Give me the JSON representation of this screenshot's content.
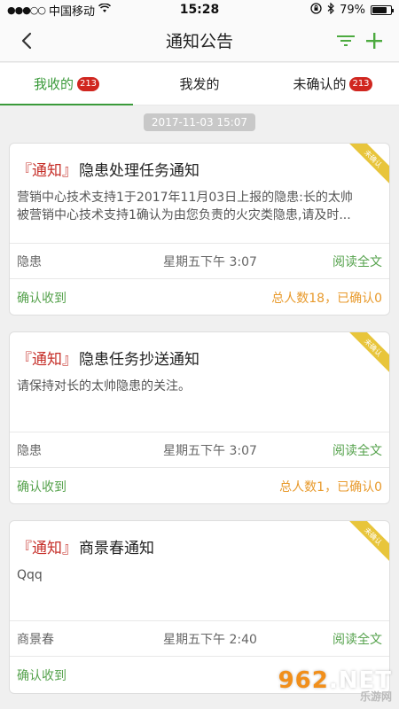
{
  "status_bar": {
    "carrier": "中国移动",
    "time": "15:28",
    "battery": "79%",
    "battery_level": 0.79
  },
  "nav": {
    "title": "通知公告"
  },
  "tabs": [
    {
      "label": "我收的",
      "badge": "213",
      "active": true
    },
    {
      "label": "我发的",
      "badge": "",
      "active": false
    },
    {
      "label": "未确认的",
      "badge": "213",
      "active": false
    }
  ],
  "date_chip": "2017-11-03 15:07",
  "cards": [
    {
      "tag": "『通知』",
      "title": "隐患处理任务通知",
      "ribbon": "未确认",
      "body_line1": "营销中心技术支持1于2017年11月03日上报的隐患:长的太帅",
      "body_line2": "被营销中心技术支持1确认为由您负责的火灾类隐患,请及时...",
      "category": "隐患",
      "time": "星期五下午 3:07",
      "read_label": "阅读全文",
      "confirm_label": "确认收到",
      "counts": "总人数18，已确认0"
    },
    {
      "tag": "『通知』",
      "title": "隐患任务抄送通知",
      "ribbon": "未确认",
      "body_line1": "请保持对长的太帅隐患的关注。",
      "body_line2": "",
      "category": "隐患",
      "time": "星期五下午 3:07",
      "read_label": "阅读全文",
      "confirm_label": "确认收到",
      "counts": "总人数1，已确认0"
    },
    {
      "tag": "『通知』",
      "title": "商景春通知",
      "ribbon": "未确认",
      "body_line1": "Qqq",
      "body_line2": "",
      "category": "商景春",
      "time": "星期五下午 2:40",
      "read_label": "阅读全文",
      "confirm_label": "确认收到",
      "counts": ""
    }
  ],
  "watermark": {
    "main_a": "962",
    "main_b": ".NET",
    "sub": "乐游网"
  }
}
